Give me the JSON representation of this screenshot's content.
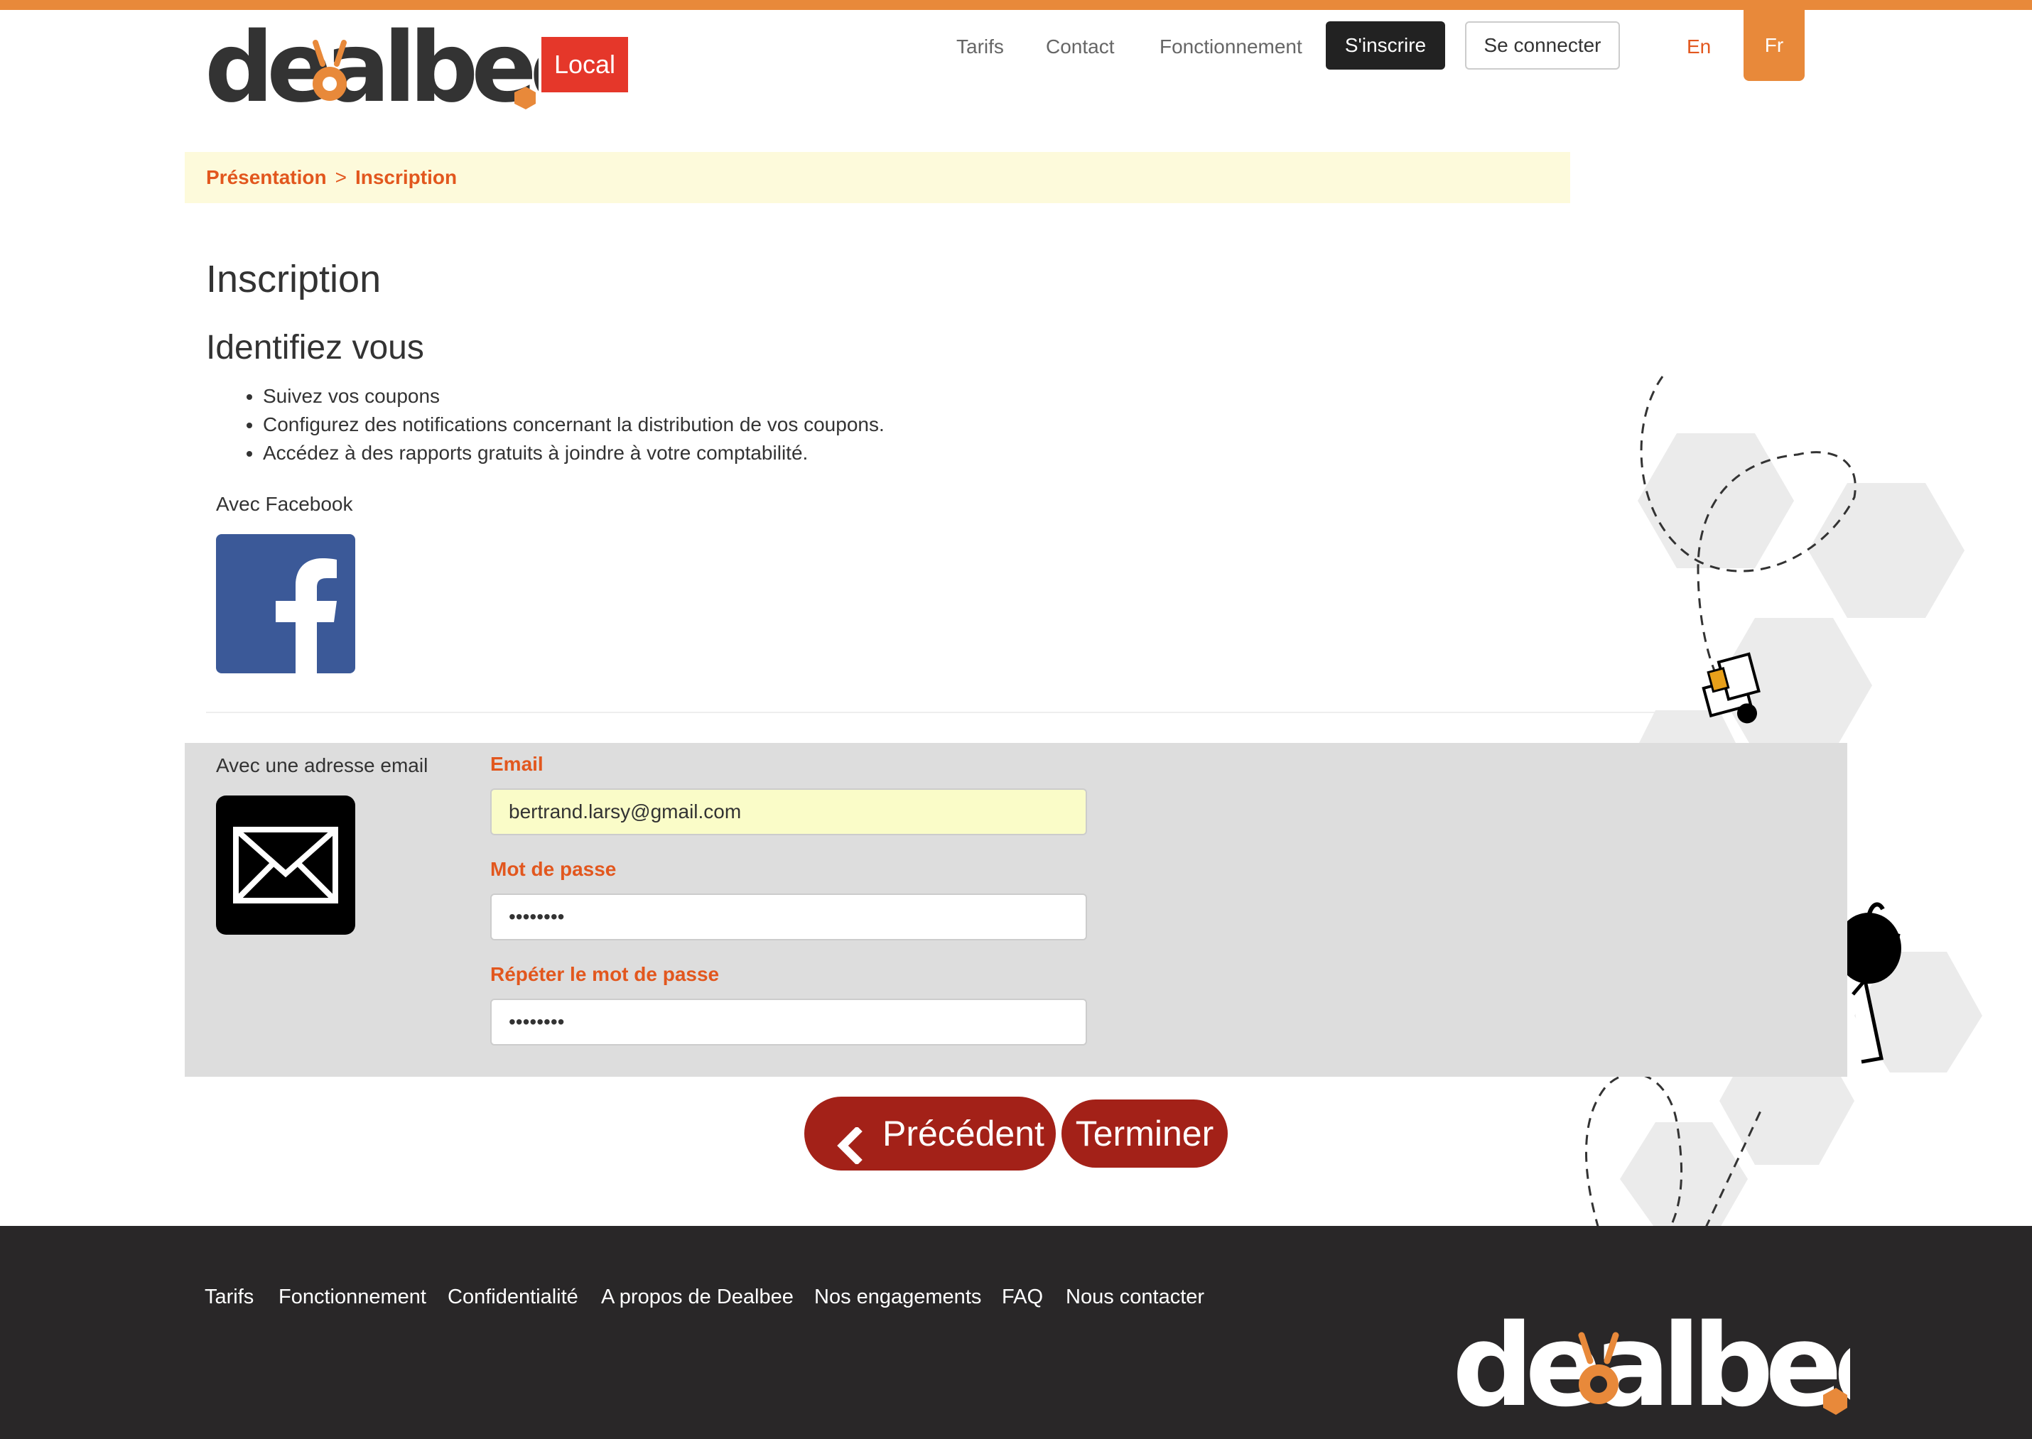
{
  "brand": {
    "logo_text": "dealbee",
    "badge": "Local",
    "accent_color": "#e8893a",
    "brand_red": "#a32118"
  },
  "nav": {
    "links": [
      "Tarifs",
      "Contact",
      "Fonctionnement"
    ],
    "signup_label": "S'inscrire",
    "login_label": "Se connecter",
    "lang_en": "En",
    "lang_fr": "Fr"
  },
  "breadcrumb": {
    "items": [
      "Présentation",
      "Inscription"
    ],
    "separator": ">"
  },
  "page": {
    "title": "Inscription",
    "subtitle": "Identifiez vous",
    "benefits": [
      "Suivez vos coupons",
      "Configurez des notifications concernant la distribution de vos coupons.",
      "Accédez à des rapports gratuits à joindre à votre comptabilité."
    ]
  },
  "facebook": {
    "label": "Avec Facebook",
    "icon": "facebook-icon"
  },
  "email_form": {
    "label": "Avec une adresse email",
    "icon": "envelope-icon",
    "email_label": "Email",
    "email_value": "bertrand.larsy@gmail.com",
    "password_label": "Mot de passe",
    "password_value": "••••••••",
    "password_repeat_label": "Répéter le mot de passe",
    "password_repeat_value": "••••••••"
  },
  "actions": {
    "previous_label": "Précédent",
    "finish_label": "Terminer"
  },
  "footer": {
    "links": [
      "Tarifs",
      "Fonctionnement",
      "Confidentialité",
      "A propos de Dealbee",
      "Nos engagements",
      "FAQ",
      "Nous contacter"
    ],
    "logo_text": "dealbee"
  }
}
